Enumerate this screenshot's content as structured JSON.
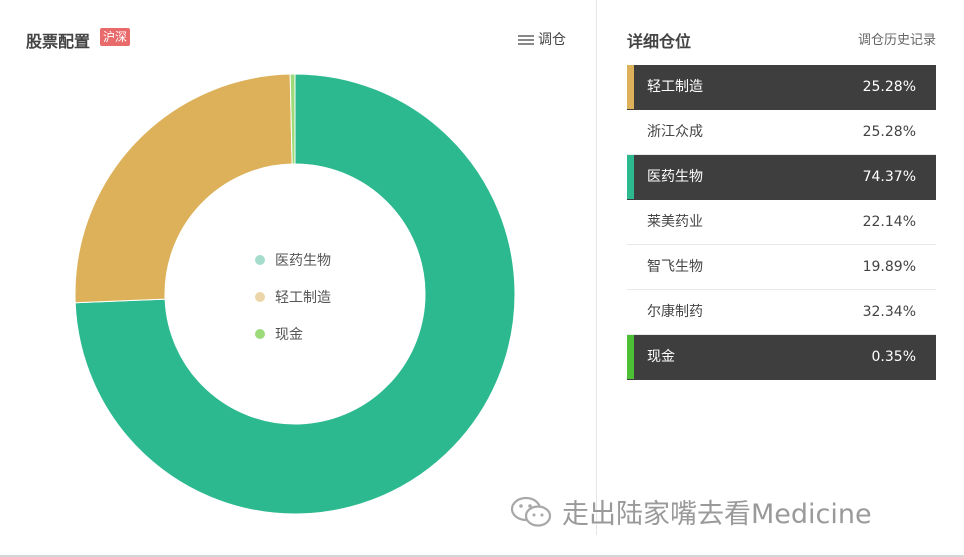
{
  "left": {
    "title": "股票配置",
    "market_badge": "沪深",
    "adjust_label": "调仓"
  },
  "right": {
    "title": "详细仓位",
    "history_link": "调仓历史记录",
    "positions": [
      {
        "name": "轻工制造",
        "pct": "25.28%",
        "style": "dark",
        "accent": "#dcb15a"
      },
      {
        "name": "浙江众成",
        "pct": "25.28%",
        "style": "light",
        "accent": ""
      },
      {
        "name": "医药生物",
        "pct": "74.37%",
        "style": "dark",
        "accent": "#2db98f"
      },
      {
        "name": "莱美药业",
        "pct": "22.14%",
        "style": "light",
        "accent": ""
      },
      {
        "name": "智飞生物",
        "pct": "19.89%",
        "style": "light",
        "accent": ""
      },
      {
        "name": "尔康制药",
        "pct": "32.34%",
        "style": "light",
        "accent": ""
      },
      {
        "name": "现金",
        "pct": "0.35%",
        "style": "dark",
        "accent": "#4cbf34"
      }
    ]
  },
  "chart_data": {
    "type": "pie",
    "donut": true,
    "title": "",
    "legend_position": "center",
    "slices": [
      {
        "name": "医药生物",
        "value": 74.37,
        "color": "#2db98f"
      },
      {
        "name": "轻工制造",
        "value": 25.28,
        "color": "#dcb15a"
      },
      {
        "name": "现金",
        "value": 0.35,
        "color": "#9ddb7a"
      }
    ],
    "legend": [
      {
        "name": "医药生物",
        "color": "#a6dccb"
      },
      {
        "name": "轻工制造",
        "color": "#ecd5a8"
      },
      {
        "name": "现金",
        "color": "#9ddb7a"
      }
    ]
  },
  "watermark": {
    "text": "走出陆家嘴去看Medicine",
    "icon": "wechat-icon"
  }
}
